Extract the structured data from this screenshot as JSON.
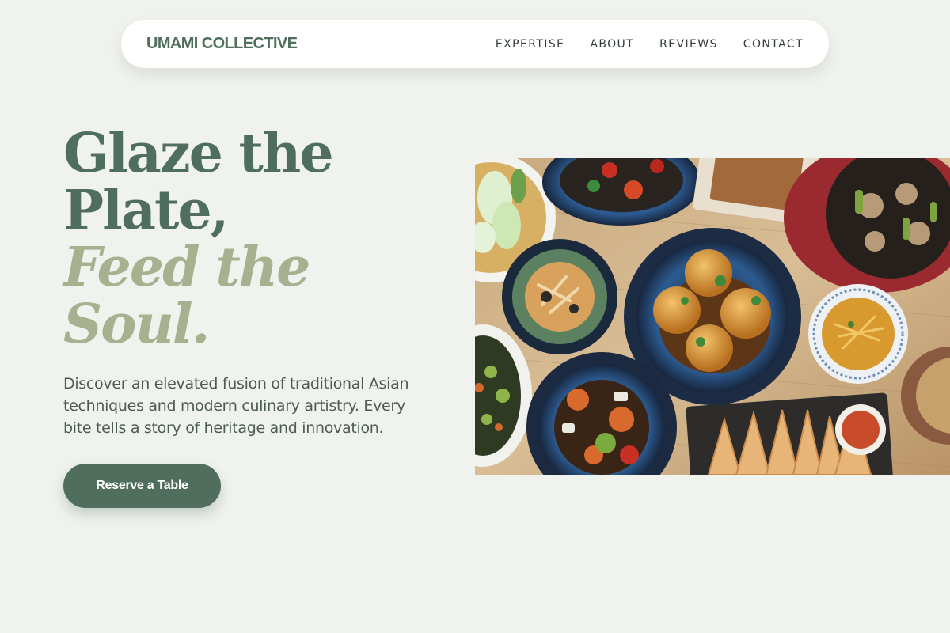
{
  "header": {
    "brand": "UMAMI COLLECTIVE",
    "nav": [
      {
        "label": "EXPERTISE"
      },
      {
        "label": "ABOUT"
      },
      {
        "label": "REVIEWS"
      },
      {
        "label": "CONTACT"
      }
    ]
  },
  "hero": {
    "title_line1": "Glaze the",
    "title_line2": "Plate,",
    "title_line3": "Feed the",
    "title_line4": "Soul.",
    "description": "Discover an elevated fusion of traditional Asian techniques and modern culinary artistry. Every bite tells a story of heritage and innovation.",
    "cta_label": "Reserve a Table"
  },
  "colors": {
    "background": "#f0f2ee",
    "primary_green": "#4f6e5d",
    "accent_sage": "#a7b18f"
  }
}
